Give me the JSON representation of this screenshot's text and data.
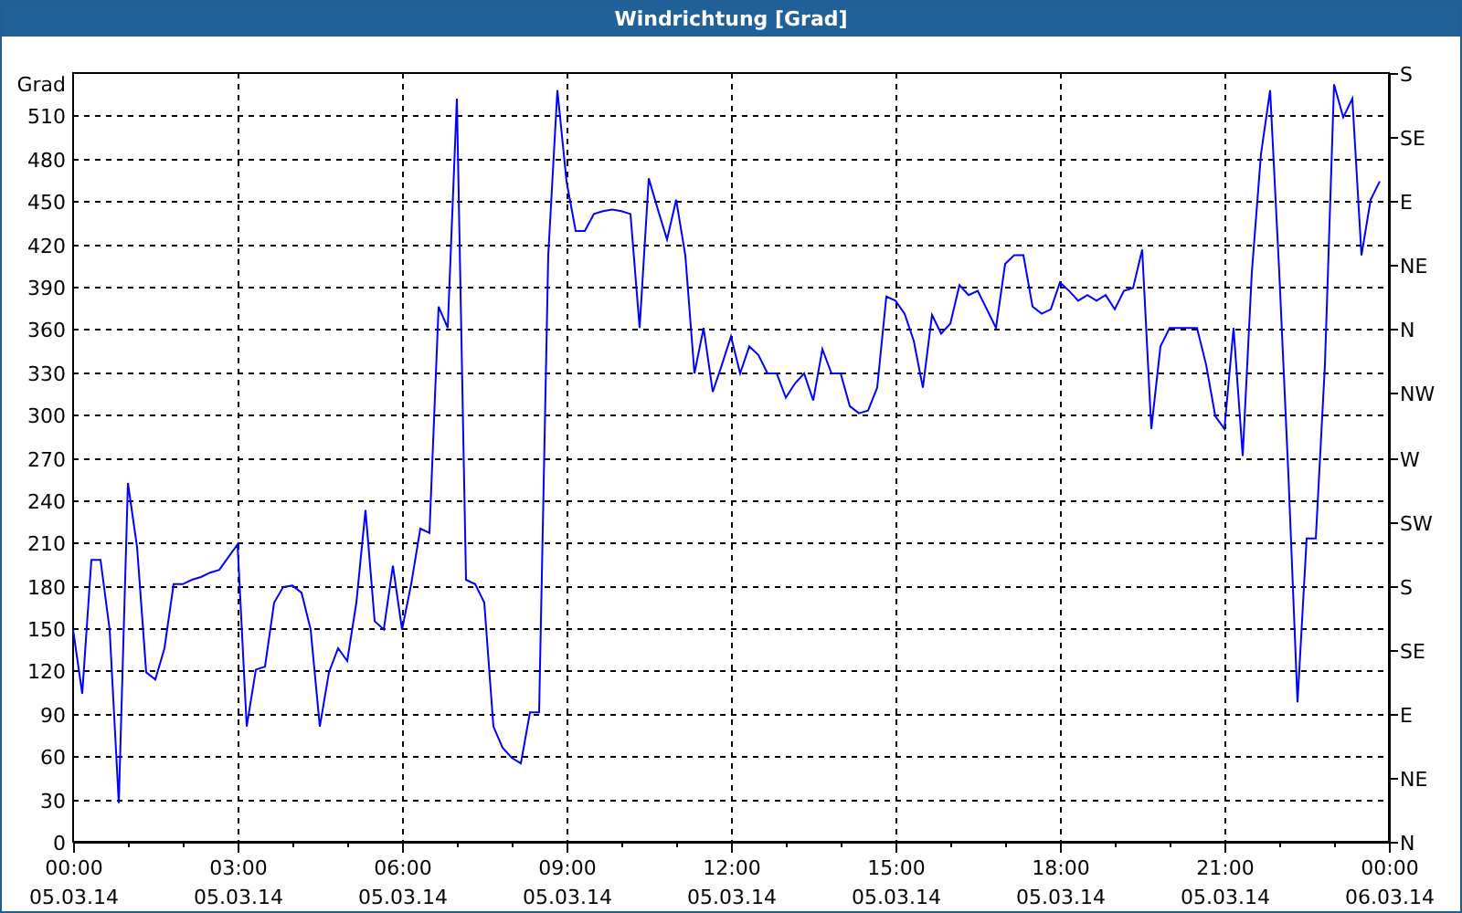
{
  "window": {
    "title": "Windrichtung [Grad]"
  },
  "chart": {
    "chart_data": {
      "type": "line",
      "ylabel": "Grad",
      "ylim": [
        0,
        540
      ],
      "grid": true,
      "categories": [
        "00:00 05.03.14",
        null,
        null,
        null,
        null,
        null,
        null,
        null,
        null,
        null,
        null,
        null,
        null,
        null,
        null,
        null,
        null,
        null,
        "03:00 05.03.14",
        null,
        null,
        null,
        null,
        null,
        null,
        null,
        null,
        null,
        null,
        null,
        null,
        null,
        null,
        null,
        null,
        null,
        "06:00 05.03.14",
        null,
        null,
        null,
        null,
        null,
        null,
        null,
        null,
        null,
        null,
        null,
        null,
        null,
        null,
        null,
        null,
        null,
        "09:00 05.03.14",
        null,
        null,
        null,
        null,
        null,
        null,
        null,
        null,
        null,
        null,
        null,
        null,
        null,
        null,
        null,
        null,
        null,
        "12:00 05.03.14",
        null,
        null,
        null,
        null,
        null,
        null,
        null,
        null,
        null,
        null,
        null,
        null,
        null,
        null,
        null,
        null,
        null,
        "15:00 05.03.14",
        null,
        null,
        null,
        null,
        null,
        null,
        null,
        null,
        null,
        null,
        null,
        null,
        null,
        null,
        null,
        null,
        null,
        "18:00 05.03.14",
        null,
        null,
        null,
        null,
        null,
        null,
        null,
        null,
        null,
        null,
        null,
        null,
        null,
        null,
        null,
        null,
        null,
        "21:00 05.03.14",
        null,
        null,
        null,
        null,
        null,
        null,
        null,
        null,
        null,
        null,
        null,
        null,
        null,
        null,
        null,
        null,
        null,
        "00:00 06.03.14"
      ],
      "yticks": [
        0,
        30,
        60,
        90,
        120,
        150,
        180,
        210,
        240,
        270,
        300,
        330,
        360,
        390,
        420,
        450,
        480,
        510
      ],
      "series": [
        {
          "color": "#0000ff",
          "values": [
            149,
            104,
            198,
            198,
            149,
            27,
            252,
            207,
            119,
            114,
            136,
            181,
            181,
            184,
            186,
            189,
            191,
            200,
            209,
            81,
            121,
            123,
            168,
            179,
            180,
            175,
            149,
            81,
            119,
            136,
            127,
            168,
            233,
            155,
            149,
            194,
            149,
            181,
            220,
            217,
            376,
            361,
            522,
            184,
            181,
            168,
            81,
            66,
            59,
            55,
            91,
            91,
            412,
            528,
            464,
            429,
            429,
            441,
            443,
            444,
            443,
            441,
            361,
            466,
            444,
            423,
            451,
            412,
            329,
            361,
            316,
            335,
            355,
            329,
            348,
            342,
            329,
            329,
            312,
            322,
            329,
            310,
            346,
            329,
            329,
            306,
            301,
            303,
            319,
            383,
            380,
            371,
            352,
            319,
            370,
            357,
            364,
            391,
            384,
            387,
            374,
            361,
            406,
            412,
            412,
            376,
            371,
            374,
            393,
            387,
            380,
            384,
            380,
            384,
            374,
            387,
            389,
            416,
            290,
            348,
            361,
            361,
            361,
            361,
            335,
            299,
            290,
            361,
            271,
            400,
            483,
            528,
            400,
            258,
            98,
            213,
            213,
            335,
            532,
            509,
            522,
            412,
            451,
            464,
            null
          ]
        }
      ]
    },
    "right_axis_labels": [
      "S",
      "SE",
      "E",
      "NE",
      "N",
      "NW",
      "W",
      "SW",
      "S",
      "SE",
      "E",
      "NE",
      "N"
    ]
  }
}
